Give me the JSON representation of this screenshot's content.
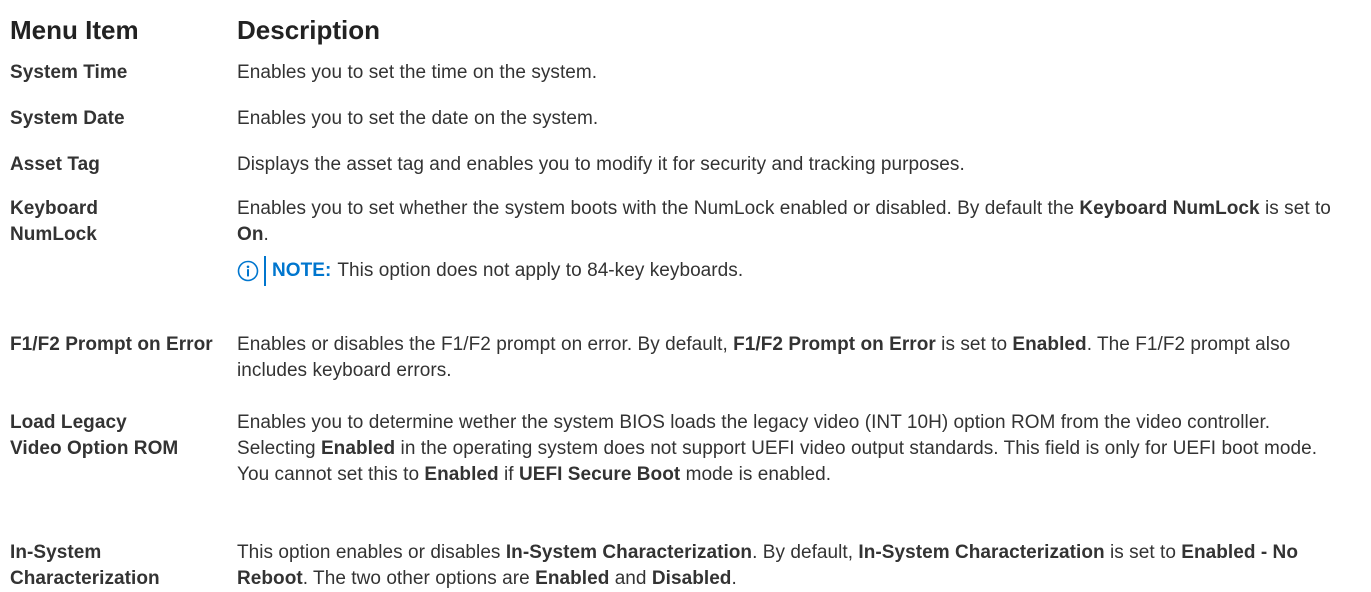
{
  "header": {
    "col_item": "Menu Item",
    "col_desc": "Description"
  },
  "colors": {
    "note_accent": "#0076ce",
    "text": "#333333"
  },
  "rows": [
    {
      "item": "System Time",
      "desc": [
        "Enables you to set the time on the system."
      ]
    },
    {
      "item": "System Date",
      "desc": [
        "Enables you to set the date on the system."
      ]
    },
    {
      "item": "Asset Tag",
      "desc": [
        "Displays the asset tag and enables you to modify it for security and tracking purposes."
      ]
    },
    {
      "item": "Keyboard NumLock",
      "desc": [
        "Enables you to set whether the system boots with the NumLock enabled or disabled. By default the ",
        "Keyboard NumLock",
        " is set to ",
        "On",
        "."
      ],
      "note_label": "NOTE:",
      "note_text": "This option does not apply to 84-key keyboards.",
      "note_icon": "info-icon"
    },
    {
      "item": "F1/F2 Prompt on Error",
      "desc": [
        "Enables or disables the F1/F2 prompt on error. By default, ",
        "F1/F2 Prompt on Error",
        " is set to ",
        "Enabled",
        ". The F1/F2 prompt also includes keyboard errors."
      ]
    },
    {
      "item": "Load Legacy Video Option ROM",
      "desc": [
        "Enables you to determine wether the system BIOS loads the legacy video (INT 10H) option ROM from the video controller. Selecting ",
        "Enabled",
        " in the operating system does not support UEFI video output standards. This field is only for UEFI boot mode. You cannot set this to ",
        "Enabled",
        " if ",
        "UEFI Secure Boot",
        " mode is enabled."
      ]
    },
    {
      "item": "In-System Characterization",
      "desc": [
        "This option enables or disables ",
        "In-System Characterization",
        ". By default, ",
        "In-System Characterization",
        " is set to ",
        "Enabled - No Reboot",
        ". The two other options are ",
        "Enabled",
        " and ",
        "Disabled",
        "."
      ]
    }
  ]
}
